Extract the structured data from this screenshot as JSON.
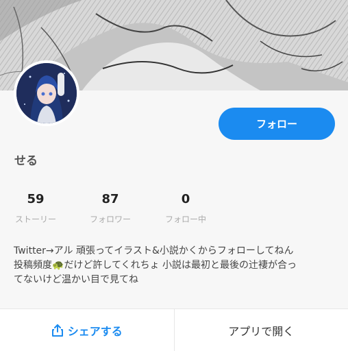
{
  "profile": {
    "follow_button": "フォロー",
    "username": "せる",
    "stats": [
      {
        "count": "59",
        "label": "ストーリー"
      },
      {
        "count": "87",
        "label": "フォロワー"
      },
      {
        "count": "0",
        "label": "フォロー中"
      }
    ],
    "bio_lines": [
      "Twitter→アル 頑張ってイラスト&小説かくからフォローしてねん",
      "投稿頻度",
      "だけど許してくれちょ 小説は最初と最後の辻褄が合っ",
      "てないけど温かい目で見てね"
    ],
    "bio_emoji": "🐢"
  },
  "footer": {
    "share_label": "シェアする",
    "open_app_label": "アプリで開く"
  },
  "colors": {
    "accent": "#1b8bf0"
  }
}
